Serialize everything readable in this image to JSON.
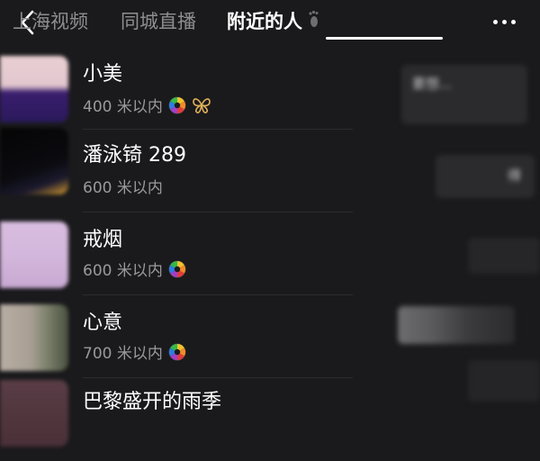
{
  "header": {
    "tabs": [
      {
        "label": "上海视频",
        "active": false
      },
      {
        "label": "同城直播",
        "active": false
      },
      {
        "label": "附近的人",
        "active": true
      }
    ]
  },
  "users": [
    {
      "name": "小美",
      "distance": "400 米以内",
      "has_badge": true,
      "has_butterfly": true
    },
    {
      "name": "潘泳锜 289",
      "distance": "600 米以内",
      "has_badge": false,
      "has_butterfly": false
    },
    {
      "name": "戒烟",
      "distance": "600 米以内",
      "has_badge": true,
      "has_butterfly": false
    },
    {
      "name": "心意",
      "distance": "700 米以内",
      "has_badge": true,
      "has_butterfly": false
    },
    {
      "name": "巴黎盛开的雨季",
      "distance": "",
      "has_badge": false,
      "has_butterfly": false
    }
  ],
  "right_panel": {
    "snippet_1": "要想...",
    "snippet_2": "得"
  },
  "colors": {
    "background": "#1a1a1c",
    "active_tab": "#ffffff",
    "inactive_tab": "#8e8e92",
    "distance_text": "#9a9a9e",
    "butterfly": "#e0b15a"
  }
}
